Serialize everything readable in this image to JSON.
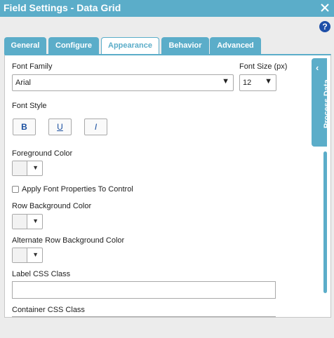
{
  "window": {
    "title": "Field Settings - Data Grid",
    "help_label": "?"
  },
  "tabs": [
    {
      "label": "General",
      "active": false
    },
    {
      "label": "Configure",
      "active": false
    },
    {
      "label": "Appearance",
      "active": true
    },
    {
      "label": "Behavior",
      "active": false
    },
    {
      "label": "Advanced",
      "active": false
    }
  ],
  "appearance": {
    "font_family": {
      "label": "Font Family",
      "value": "Arial"
    },
    "font_size": {
      "label": "Font Size (px)",
      "value": "12"
    },
    "font_style": {
      "label": "Font Style",
      "bold": "B",
      "underline": "U",
      "italic": "I"
    },
    "foreground_color": {
      "label": "Foreground Color"
    },
    "apply_font": {
      "label": "Apply Font Properties To Control",
      "checked": false
    },
    "row_bg_color": {
      "label": "Row Background Color"
    },
    "alt_row_bg_color": {
      "label": "Alternate Row Background Color"
    },
    "label_css": {
      "label": "Label CSS Class",
      "value": ""
    },
    "container_css": {
      "label": "Container CSS Class"
    }
  },
  "side_panel": {
    "label": "Process Data"
  },
  "colors": {
    "accent": "#5badc9",
    "help": "#1f4fa8"
  }
}
